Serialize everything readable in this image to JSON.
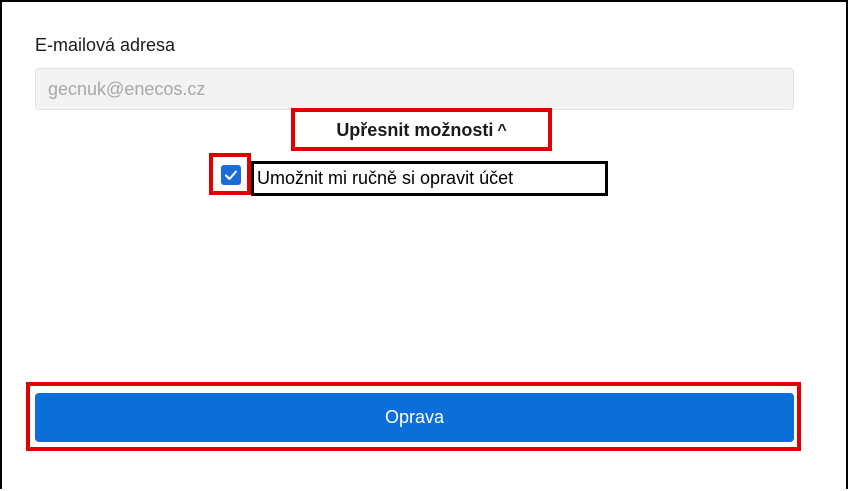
{
  "form": {
    "email_label": "E-mailová adresa",
    "email_value": "gecnuk@enecos.cz",
    "refine_label": "Upřesnit možnosti",
    "refine_chevron": "^",
    "manual_fix_label": "Umožnit mi ručně si opravit účet",
    "manual_fix_checked": true,
    "repair_button_label": "Oprava"
  },
  "colors": {
    "accent": "#0c6ed8",
    "checkbox": "#1a6dd6",
    "annotation_red": "#e00000",
    "input_bg": "#f3f3f3",
    "input_text": "#a8a8a8"
  },
  "icons": {
    "checkbox_check": "checkmark-icon",
    "refine_toggle": "chevron-up-icon"
  }
}
